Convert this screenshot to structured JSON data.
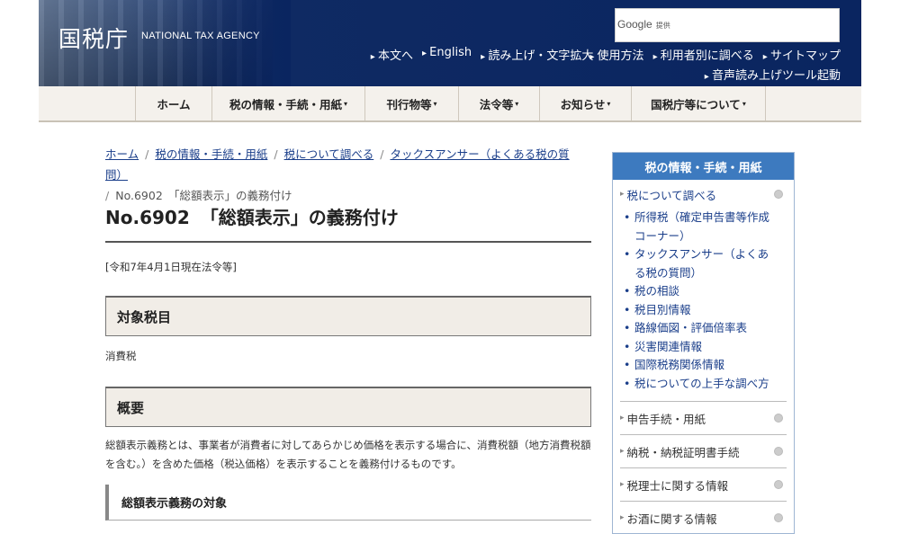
{
  "header": {
    "logo": "国税庁",
    "logo_en": "NATIONAL TAX AGENCY",
    "search_brand": "Google",
    "search_sub": "提供",
    "links": [
      "本文へ",
      "English",
      "読み上げ・文字拡大",
      "使用方法",
      "利用者別に調べる",
      "サイトマップ"
    ],
    "link2": "音声読み上げツール起動"
  },
  "nav": {
    "items": [
      {
        "label": "ホーム",
        "caret": ""
      },
      {
        "label": "税の情報・手続・用紙",
        "caret": "▾"
      },
      {
        "label": "刊行物等",
        "caret": "▾"
      },
      {
        "label": "法令等",
        "caret": "▾"
      },
      {
        "label": "お知らせ",
        "caret": "▾"
      },
      {
        "label": "国税庁等について",
        "caret": "▾"
      }
    ]
  },
  "breadcrumb": {
    "items": [
      "ホーム",
      "税の情報・手続・用紙",
      "税について調べる",
      "タックスアンサー（よくある税の質問）"
    ],
    "current": "No.6902　「総額表示」の義務付け"
  },
  "main": {
    "title_no": "No.6902",
    "title": "「総額表示」の義務付け",
    "date": "[令和7年4月1日現在法令等]",
    "section1": "対象税目",
    "section1_text": "消費税",
    "section2": "概要",
    "section2_text": "総額表示義務とは、事業者が消費者に対してあらかじめ価格を表示する場合に、消費税額（地方消費税額を含む。）を含めた価格（税込価格）を表示することを義務付けるものです。",
    "subsection": "総額表示義務の対象"
  },
  "sidebar": {
    "head": "税の情報・手続・用紙",
    "current": "税について調べる",
    "items": [
      "所得税（確定申告書等作成コーナー）",
      "タックスアンサー（よくある税の質問）",
      "税の相談",
      "税目別情報",
      "路線価図・評価倍率表",
      "災害関連情報",
      "国際税務関係情報",
      "税についての上手な調べ方"
    ],
    "sections": [
      "申告手続・用紙",
      "納税・納税証明書手続",
      "税理士に関する情報",
      "お酒に関する情報"
    ]
  }
}
